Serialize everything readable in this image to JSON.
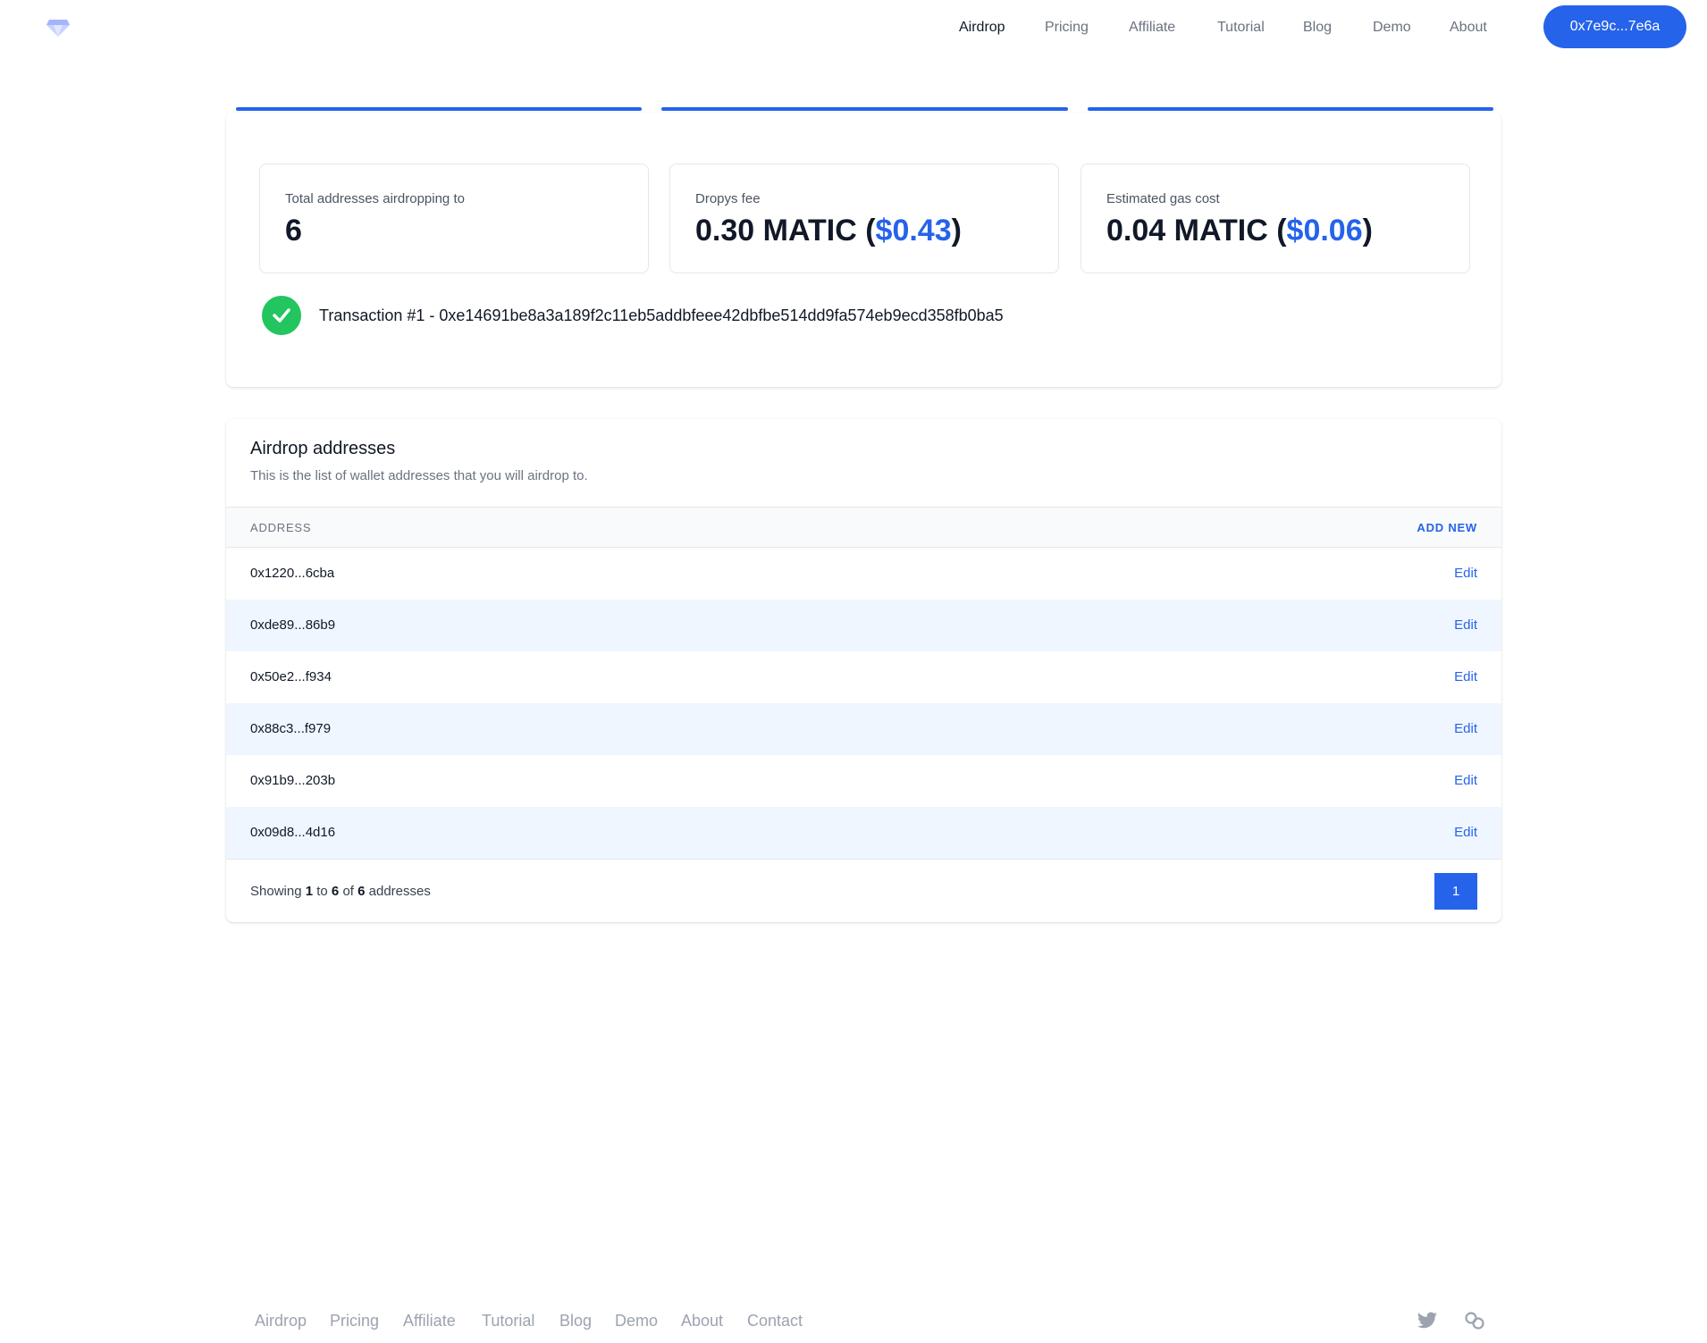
{
  "header": {
    "logo_icon": "diamond-logo-icon",
    "nav": [
      {
        "label": "Airdrop",
        "active": true
      },
      {
        "label": "Pricing"
      },
      {
        "label": "Affiliate"
      },
      {
        "label": "Tutorial"
      },
      {
        "label": "Blog"
      },
      {
        "label": "Demo"
      },
      {
        "label": "About"
      }
    ],
    "wallet": "0x7e9c...7e6a"
  },
  "summary": {
    "stats": [
      {
        "label": "Total addresses airdropping to",
        "value": "6"
      },
      {
        "label": "Dropys fee",
        "value": "0.30 MATIC",
        "usd": "$0.43"
      },
      {
        "label": "Estimated gas cost",
        "value": "0.04 MATIC",
        "usd": "$0.06"
      }
    ],
    "transaction": "Transaction #1 - 0xe14691be8a3a189f2c11eb5addbfeee42dbfbe514dd9fa574eb9ecd358fb0ba5"
  },
  "addresses": {
    "title": "Airdrop addresses",
    "subtitle": "This is the list of wallet addresses that you will airdrop to.",
    "col_address": "ADDRESS",
    "add_new": "ADD NEW",
    "edit_label": "Edit",
    "rows": [
      "0x1220...6cba",
      "0xde89...86b9",
      "0x50e2...f934",
      "0x88c3...f979",
      "0x91b9...203b",
      "0x09d8...4d16"
    ],
    "showing_prefix": "Showing",
    "showing_from": "1",
    "showing_to_word": "to",
    "showing_to": "6",
    "showing_of_word": "of",
    "showing_total": "6",
    "showing_suffix": "addresses",
    "page": "1"
  },
  "footer": {
    "links": [
      "Airdrop",
      "Pricing",
      "Affiliate",
      "Tutorial",
      "Blog",
      "Demo",
      "About",
      "Contact"
    ],
    "icons": [
      "twitter-icon",
      "link-icon"
    ]
  },
  "colors": {
    "accent": "#2563eb",
    "success": "#22c55e",
    "row_alt": "#eff6ff"
  }
}
